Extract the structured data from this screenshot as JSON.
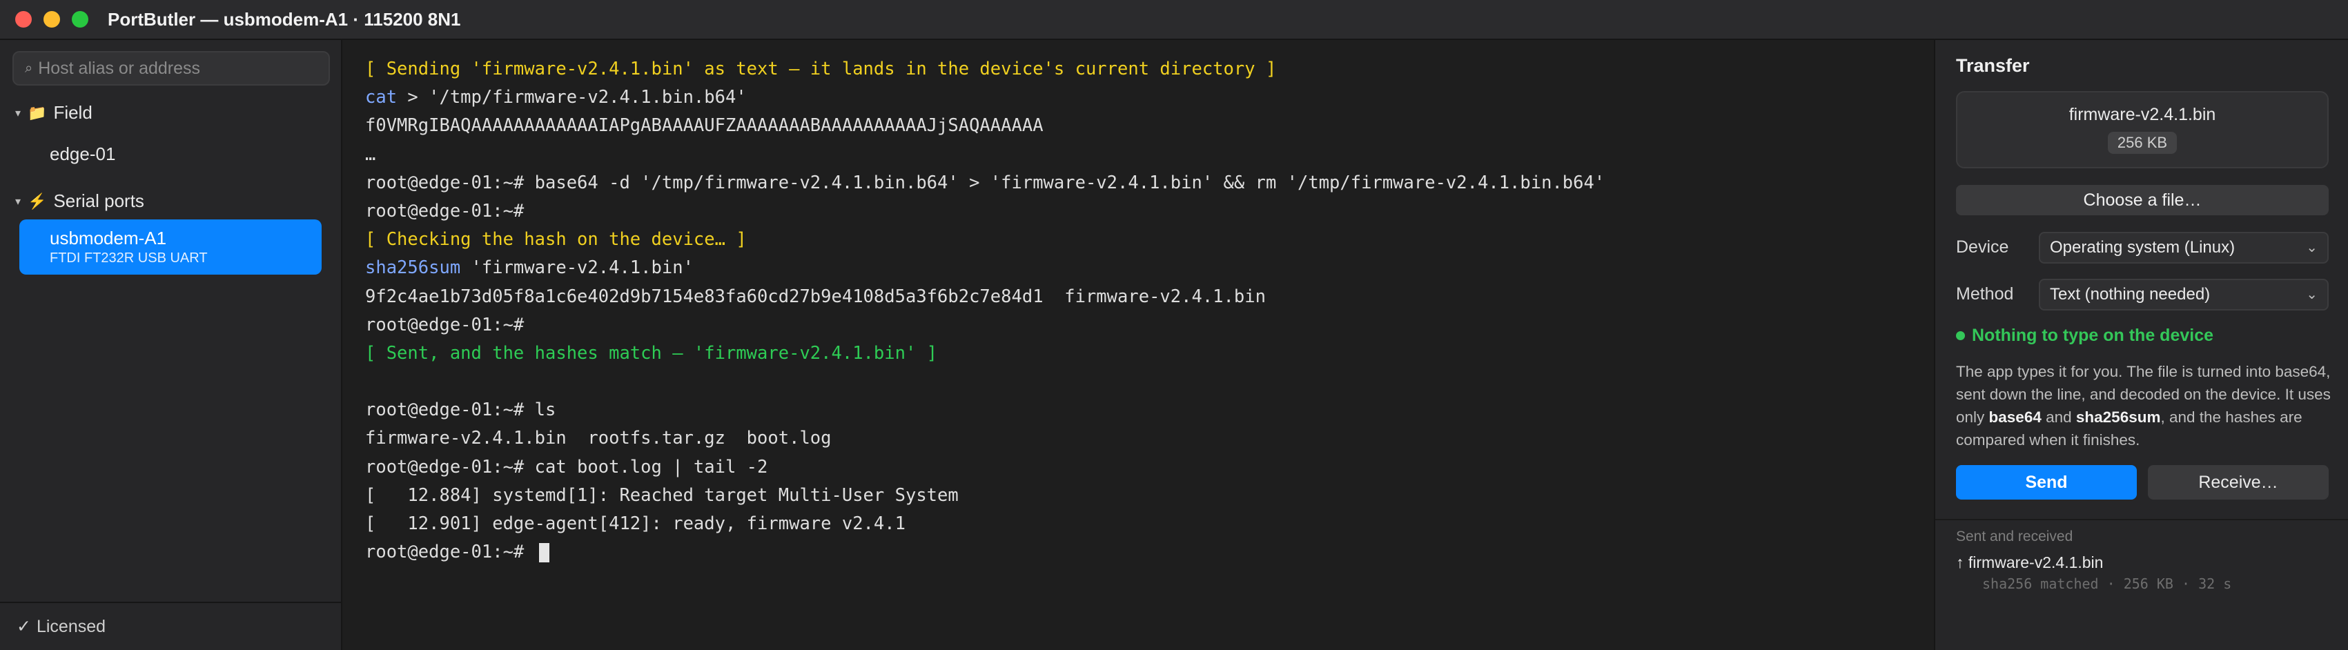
{
  "window": {
    "title": "PortButler — usbmodem-A1 · 115200 8N1"
  },
  "sidebar": {
    "search_placeholder": "Host alias or address",
    "groups": [
      {
        "label": "Field",
        "icon": "folder-icon",
        "items": [
          "edge-01"
        ]
      },
      {
        "label": "Serial ports",
        "icon": "bolt-icon",
        "items": [
          {
            "name": "usbmodem-A1",
            "detail": "FTDI FT232R USB UART",
            "selected": true
          }
        ]
      }
    ],
    "footer": "Licensed",
    "accent": "#0a84ff"
  },
  "terminal": {
    "lines": [
      {
        "text": "[ Sending 'firmware-v2.4.1.bin' as text — it lands in the device's current directory ]",
        "style": "yellow"
      },
      {
        "cmd": "cat",
        "text": " > '/tmp/firmware-v2.4.1.bin.b64'",
        "style": "cmd"
      },
      {
        "text": "f0VMRgIBAQAAAAAAAAAAAAIAPgABAAAAUFZAAAAAAABAAAAAAAAAAJjSAQAAAAAA",
        "style": "normal"
      },
      {
        "text": "…",
        "style": "normal"
      },
      {
        "text": "root@edge-01:~# base64 -d '/tmp/firmware-v2.4.1.bin.b64' > 'firmware-v2.4.1.bin' && rm '/tmp/firmware-v2.4.1.bin.b64'",
        "style": "normal"
      },
      {
        "text": "root@edge-01:~#",
        "style": "normal"
      },
      {
        "text": "[ Checking the hash on the device… ]",
        "style": "yellow"
      },
      {
        "cmd": "sha256sum",
        "text": " 'firmware-v2.4.1.bin'",
        "style": "cmd"
      },
      {
        "text": "9f2c4ae1b73d05f8a1c6e402d9b7154e83fa60cd27b9e4108d5a3f6b2c7e84d1  firmware-v2.4.1.bin",
        "style": "normal"
      },
      {
        "text": "root@edge-01:~#",
        "style": "normal"
      },
      {
        "text": "[ Sent, and the hashes match — 'firmware-v2.4.1.bin' ]",
        "style": "green"
      },
      {
        "text": "",
        "style": "normal"
      },
      {
        "text": "root@edge-01:~# ls",
        "style": "normal"
      },
      {
        "text": "firmware-v2.4.1.bin  rootfs.tar.gz  boot.log",
        "style": "normal"
      },
      {
        "text": "root@edge-01:~# cat boot.log | tail -2",
        "style": "normal"
      },
      {
        "text": "[   12.884] systemd[1]: Reached target Multi-User System",
        "style": "normal"
      },
      {
        "text": "[   12.901] edge-agent[412]: ready, firmware v2.4.1",
        "style": "normal"
      },
      {
        "text": "root@edge-01:~# ",
        "style": "prompt"
      }
    ]
  },
  "transfer": {
    "title": "Transfer",
    "file_name": "firmware-v2.4.1.bin",
    "file_size": "256 KB",
    "choose_label": "Choose a file…",
    "device_label": "Device",
    "device_value": "Operating system (Linux)",
    "method_label": "Method",
    "method_value": "Text (nothing needed)",
    "status": "Nothing to type on the device",
    "status_color": "#34c759",
    "desc_1": "The app types it for you. The file is turned into base64, sent down the line, and decoded on the device. It uses only ",
    "desc_b1": "base64",
    "desc_2": " and ",
    "desc_b2": "sha256sum",
    "desc_3": ", and the hashes are compared when it finishes.",
    "send_label": "Send",
    "receive_label": "Receive…",
    "history_title": "Sent and received",
    "history": [
      {
        "arrow": "↑",
        "name": "firmware-v2.4.1.bin",
        "meta": "sha256 matched · 256 KB · 32 s"
      }
    ]
  }
}
